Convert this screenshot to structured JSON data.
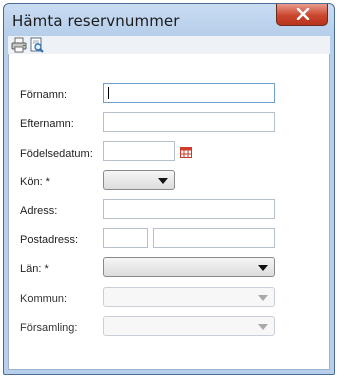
{
  "window": {
    "title": "Hämta reservnummer"
  },
  "toolbar": {
    "icons": [
      "printer-icon",
      "print-preview-icon"
    ]
  },
  "form": {
    "fornamn": {
      "label": "Förnamn:",
      "value": ""
    },
    "efternamn": {
      "label": "Efternamn:",
      "value": ""
    },
    "fodelsedatum": {
      "label": "Födelsedatum:",
      "value": ""
    },
    "kon": {
      "label": "Kön: *",
      "value": ""
    },
    "adress": {
      "label": "Adress:",
      "value": ""
    },
    "postadress": {
      "label": "Postadress:",
      "postnummer": "",
      "ort": ""
    },
    "lan": {
      "label": "Län: *",
      "value": ""
    },
    "kommun": {
      "label": "Kommun:",
      "value": ""
    },
    "forsamling": {
      "label": "Församling:",
      "value": ""
    }
  },
  "colors": {
    "titlebar": "#b7cfeb",
    "close_button": "#c9462d",
    "calendar_icon": "#d33a2a"
  }
}
